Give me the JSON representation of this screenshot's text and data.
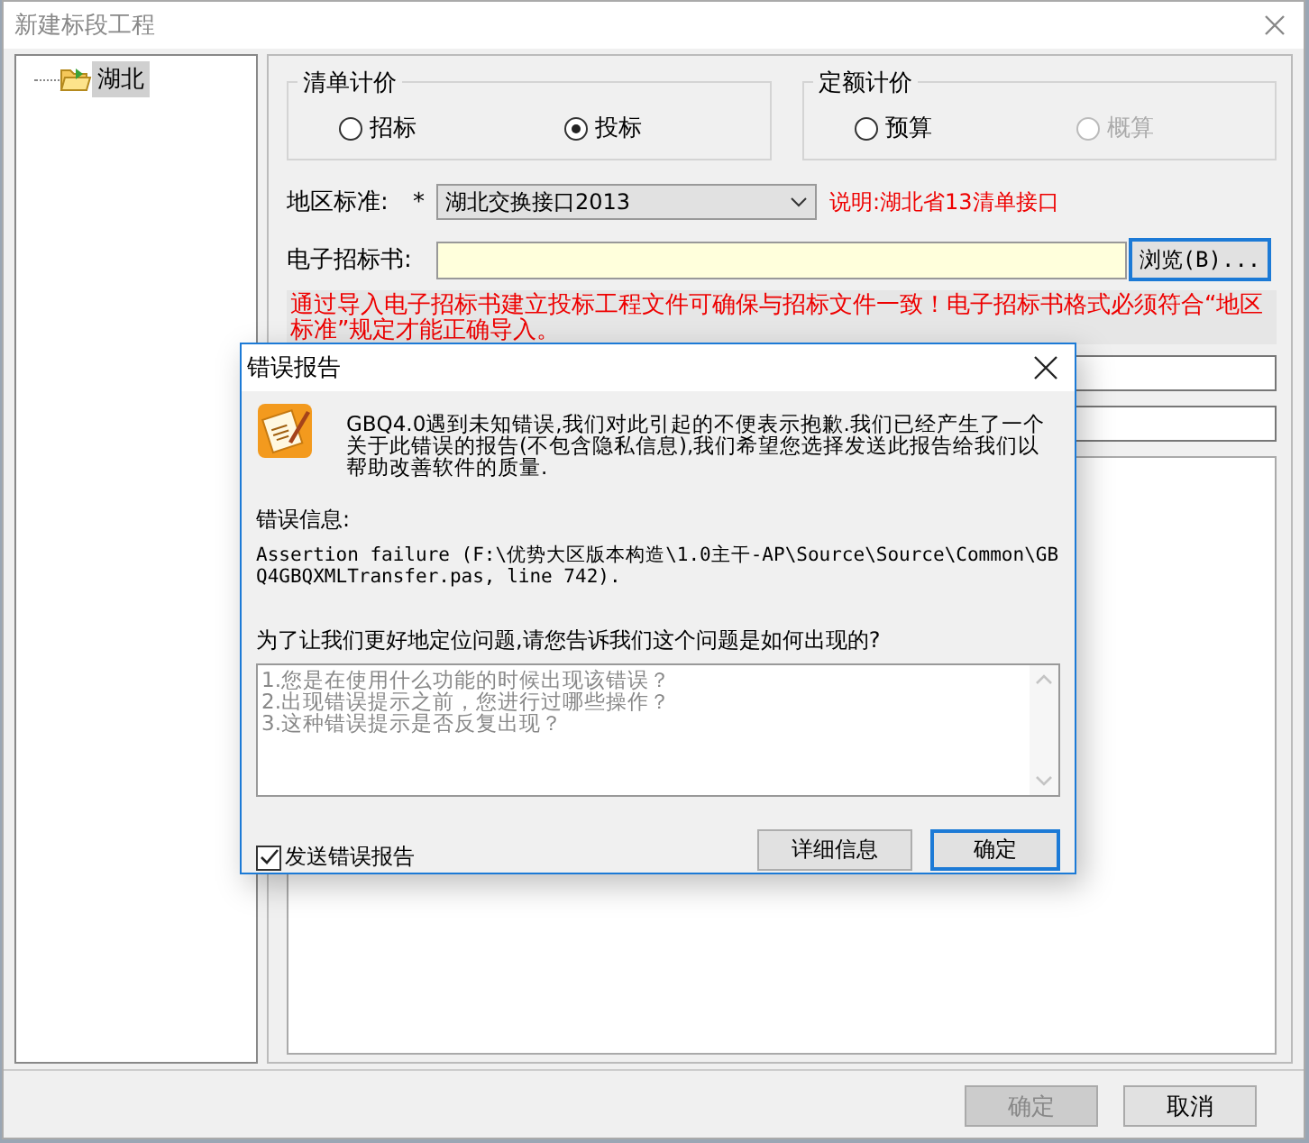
{
  "window": {
    "title": "新建标段工程"
  },
  "tree": [
    {
      "label": "湖北",
      "selected": true
    }
  ],
  "bill_pricing": {
    "title": "清单计价",
    "options": [
      {
        "label": "招标",
        "selected": false,
        "disabled": false
      },
      {
        "label": "投标",
        "selected": true,
        "disabled": false
      }
    ]
  },
  "quota_pricing": {
    "title": "定额计价",
    "options": [
      {
        "label": "预算",
        "selected": false,
        "disabled": false
      },
      {
        "label": "概算",
        "selected": false,
        "disabled": true
      }
    ]
  },
  "region_standard": {
    "label": "地区标准:",
    "required_mark": "*",
    "value": "湖北交换接口2013",
    "note": "说明:湖北省13清单接口"
  },
  "tender_file": {
    "label": "电子招标书:",
    "browse_button": "浏览(B)..."
  },
  "notice": "通过导入电子招标书建立投标工程文件可确保与招标文件一致！电子招标书格式必须符合“地区标准”规定才能正确导入。",
  "footer_buttons": [
    {
      "label": "确定",
      "disabled": true
    },
    {
      "label": "取消",
      "disabled": false
    }
  ],
  "error_dialog": {
    "title": "错误报告",
    "message": "GBQ4.0遇到未知错误,我们对此引起的不便表示抱歉.我们已经产生了一个关于此错误的报告(不包含隐私信息),我们希望您选择发送此报告给我们以帮助改善软件的质量.",
    "info_label": "错误信息:",
    "info": "Assertion failure (F:\\优势大区版本构造\\1.0主干-AP\\Source\\Source\\Common\\GBQ4GBQXMLTransfer.pas, line 742).",
    "question": "为了让我们更好地定位问题,请您告诉我们这个问题是如何出现的?",
    "answer_placeholder": "1.您是在使用什么功能的时候出现该错误？\n2.出现错误提示之前，您进行过哪些操作？\n3.这种错误提示是否反复出现？",
    "send_report": {
      "label": "发送错误报告",
      "checked": true
    },
    "buttons": [
      {
        "label": "详细信息",
        "focused": false
      },
      {
        "label": "确定",
        "focused": true
      }
    ]
  }
}
